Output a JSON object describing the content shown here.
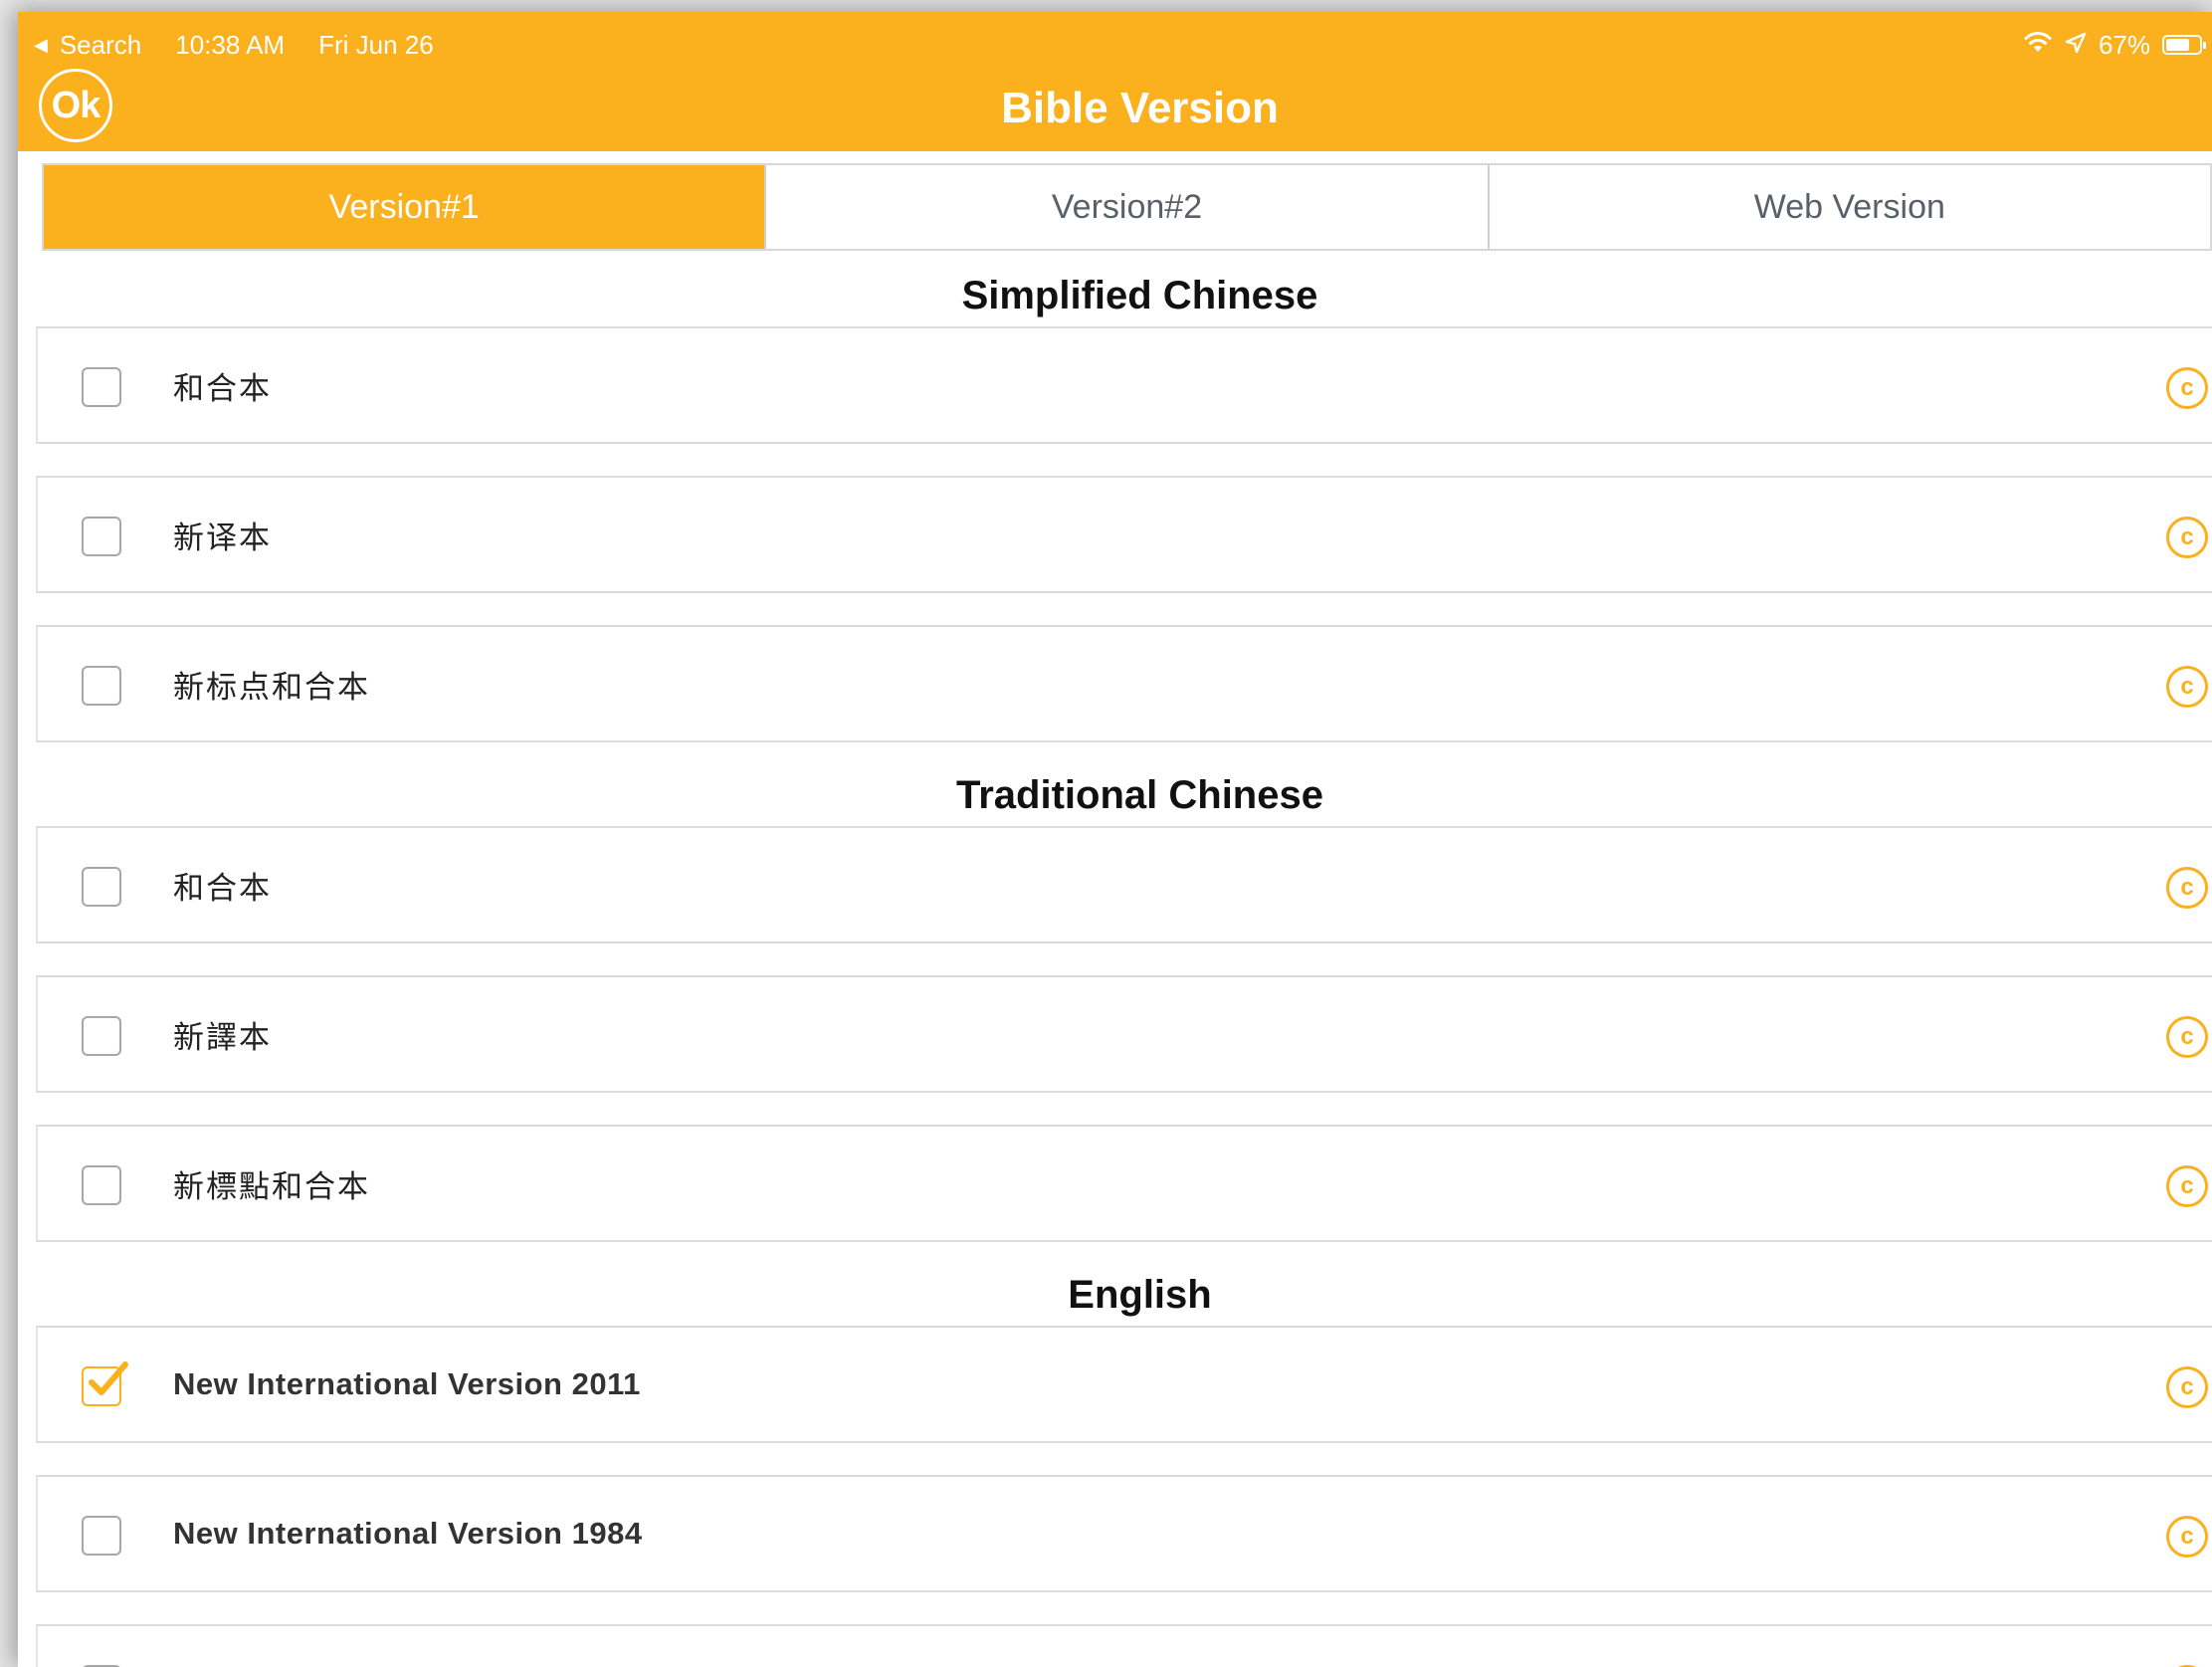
{
  "status_bar": {
    "back_label": "Search",
    "time": "10:38 AM",
    "date": "Fri Jun 26",
    "battery": "67%"
  },
  "header": {
    "ok_label": "Ok",
    "title": "Bible Version",
    "color": "#FBB01E"
  },
  "tabs": [
    {
      "label": "Version#1",
      "active": true
    },
    {
      "label": "Version#2",
      "active": false
    },
    {
      "label": "Web Version",
      "active": false
    }
  ],
  "sections": [
    {
      "heading": "Simplified Chinese",
      "items": [
        {
          "label": "和合本",
          "checked": false
        },
        {
          "label": "新译本",
          "checked": false
        },
        {
          "label": "新标点和合本",
          "checked": false
        }
      ]
    },
    {
      "heading": "Traditional Chinese",
      "items": [
        {
          "label": "和合本",
          "checked": false
        },
        {
          "label": "新譯本",
          "checked": false
        },
        {
          "label": "新標點和合本",
          "checked": false
        }
      ]
    },
    {
      "heading": "English",
      "items": [
        {
          "label": "New International Version 2011",
          "checked": true
        },
        {
          "label": "New International Version 1984",
          "checked": false
        }
      ]
    }
  ],
  "icons": {
    "copyright": "copyright-icon",
    "checkbox": "checkbox-icon",
    "checkmark": "checkmark-icon"
  },
  "copyright_symbol": "c"
}
